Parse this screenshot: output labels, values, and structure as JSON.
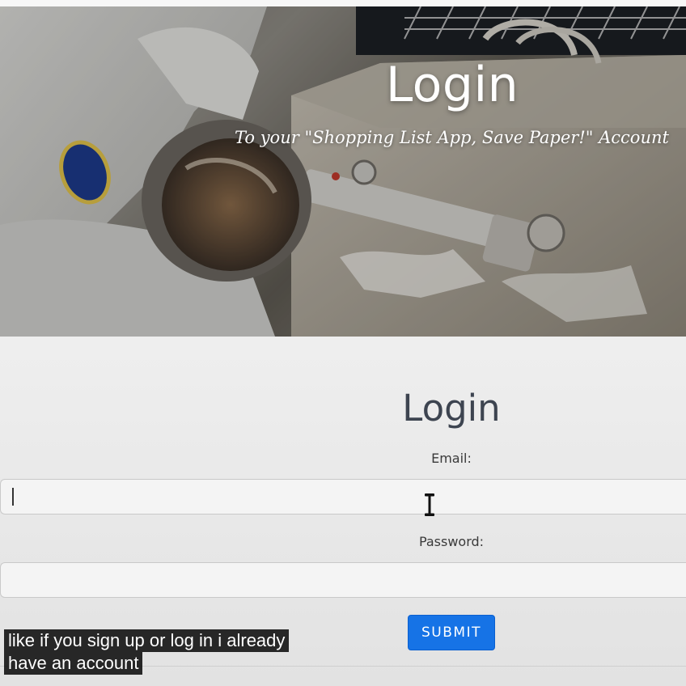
{
  "hero": {
    "title": "Login",
    "subtitle": "To your \"Shopping List App, Save Paper!\" Account"
  },
  "login_form": {
    "title": "Login",
    "email_label": "Email:",
    "email_value": "",
    "password_label": "Password:",
    "password_value": "",
    "submit_label": "SUBMIT"
  },
  "captions": {
    "line1": "like if you sign up or log in i already",
    "line2": "have an account"
  },
  "colors": {
    "submit_button": "#1673e6",
    "title_text": "#3d4450",
    "page_background": "#efefef"
  },
  "icons": [
    "text-cursor-icon"
  ]
}
